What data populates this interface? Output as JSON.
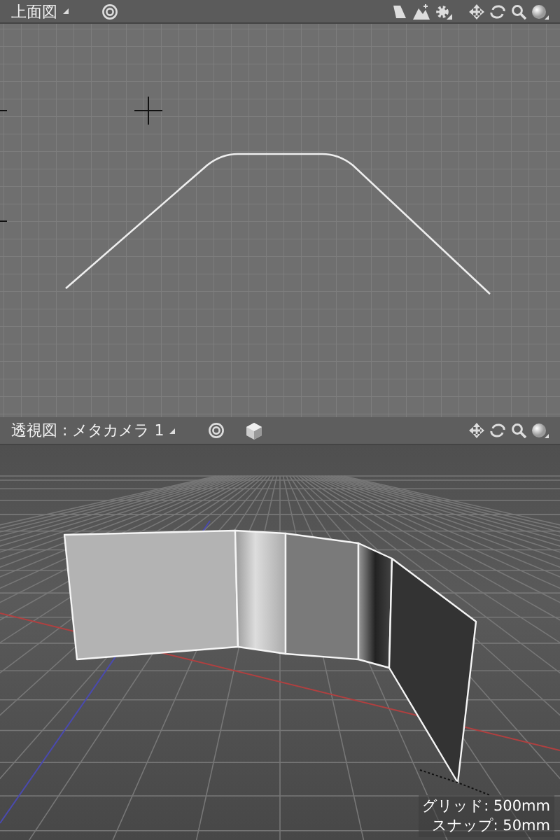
{
  "top_view": {
    "title": "上面図"
  },
  "perspective_view": {
    "title": "透視図 : メタカメラ 1"
  },
  "status_lines": [
    "グリッド: 500mm",
    "スナップ: 50mm"
  ]
}
